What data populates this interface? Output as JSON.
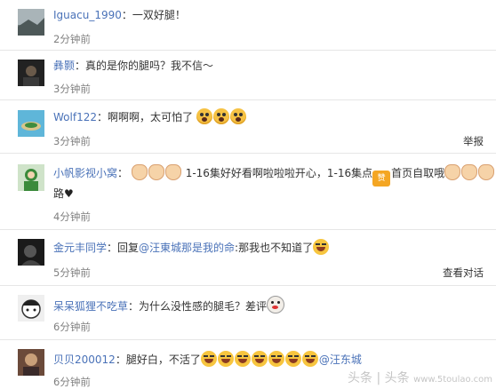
{
  "comments": [
    {
      "user": "Iguacu_1990",
      "text": "：一双好腿！",
      "time": "2分钟前"
    },
    {
      "user": "彝颢",
      "text": "：真的是你的腿吗？我不信～",
      "time": "3分钟前"
    },
    {
      "user": "Wolf122",
      "text": "：啊啊啊，太可怕了",
      "emojis": [
        "scared-face",
        "scared-face",
        "scared-face"
      ],
      "time": "3分钟前",
      "action": "举报"
    },
    {
      "user": "小帆影视小窝",
      "text_a": "：",
      "emojis_a": [
        "clap",
        "clap",
        "clap"
      ],
      "text_b": "1-16集好好看啊啦啦啦开心，1-16集点",
      "emoji_praise": "赞",
      "text_c": "首页自取哦",
      "emojis_c": [
        "clap",
        "clap",
        "clap"
      ],
      "text_d": "路",
      "heart": "♥",
      "time": "4分钟前"
    },
    {
      "user": "金元丰同学",
      "text_a": "：回复",
      "mention": "@汪東城那是我的命",
      "text_b": ":那我也不知道了",
      "emojis": [
        "laugh-cry"
      ],
      "time": "5分钟前",
      "action": "查看对话"
    },
    {
      "user": "呆呆狐狸不吃草",
      "text": "：为什么没性感的腿毛？差评",
      "emojis": [
        "pig-face"
      ],
      "time": "6分钟前"
    },
    {
      "user": "贝贝200012",
      "text": "：腿好白，不活了",
      "emojis": [
        "laugh-cry",
        "laugh-cry",
        "laugh-cry",
        "laugh-cry",
        "laugh-cry",
        "laugh-cry",
        "laugh-cry"
      ],
      "mention": "@汪东城",
      "time": "6分钟前"
    }
  ],
  "watermark": {
    "text": "头条 | 头条",
    "url": "www.5toulao.com"
  },
  "colors": {
    "username": "#4a72b8",
    "time": "#808080",
    "separator": "#e6e6e6"
  }
}
